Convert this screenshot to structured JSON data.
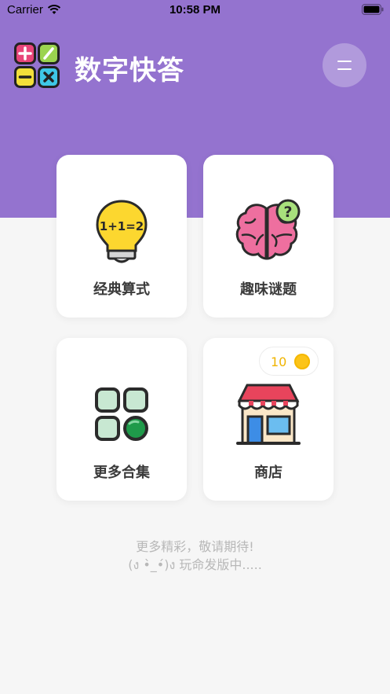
{
  "status_bar": {
    "carrier": "Carrier",
    "time": "10:58 PM"
  },
  "header": {
    "title": "数字快答",
    "logo": "math-operators-logo",
    "menu_icon": "menu-icon"
  },
  "menu": [
    {
      "label": "经典算式",
      "icon": "lightbulb-icon",
      "bulb_text": "1+1=2"
    },
    {
      "label": "趣味谜题",
      "icon": "brain-question-icon",
      "badge": "?"
    },
    {
      "label": "更多合集",
      "icon": "grid-apps-icon"
    },
    {
      "label": "商店",
      "icon": "store-icon",
      "coins": "10"
    }
  ],
  "footer": {
    "line1": "更多精彩，敬请期待!",
    "line2": "(ง •̀_•́)ง  玩命发版中....."
  },
  "colors": {
    "header_bg": "#9473cf",
    "page_bg": "#f6f6f6",
    "coin": "#fcc419"
  }
}
